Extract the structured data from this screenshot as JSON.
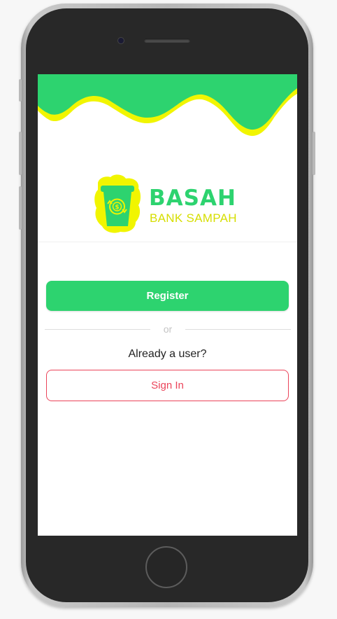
{
  "brand": {
    "name": "BASAH",
    "tagline": "BANK SAMPAH",
    "green": "#2dd36f",
    "yellow": "#f1f500"
  },
  "auth": {
    "register_label": "Register",
    "or_label": "or",
    "already_user_label": "Already a user?",
    "signin_label": "Sign In",
    "signin_color": "#eb445a"
  }
}
